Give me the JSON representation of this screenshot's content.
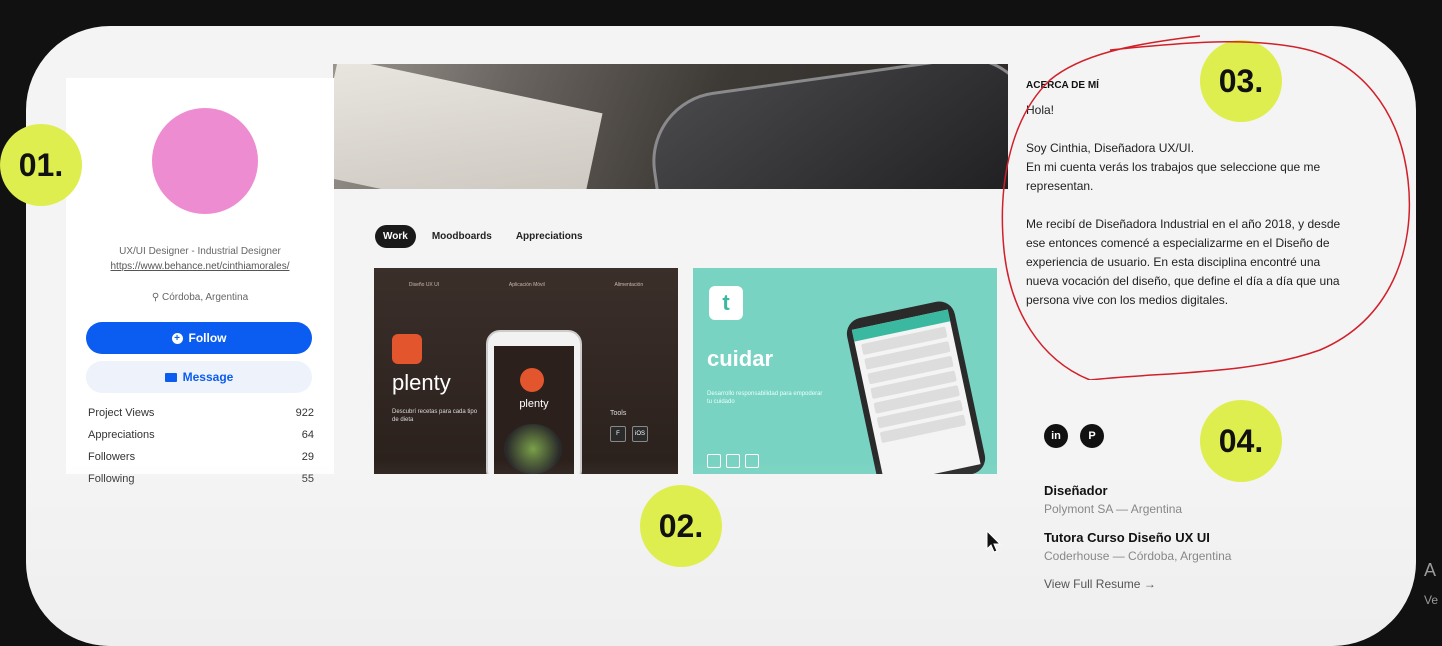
{
  "profile": {
    "role": "UX/UI Designer - Industrial Designer",
    "url": "https://www.behance.net/cinthiamorales/",
    "location": "Córdoba, Argentina",
    "follow_label": "Follow",
    "message_label": "Message",
    "stats": [
      {
        "label": "Project Views",
        "value": "922"
      },
      {
        "label": "Appreciations",
        "value": "64"
      },
      {
        "label": "Followers",
        "value": "29"
      },
      {
        "label": "Following",
        "value": "55"
      }
    ]
  },
  "tabs": [
    "Work",
    "Moodboards",
    "Appreciations"
  ],
  "projects": {
    "plenty": {
      "name": "plenty",
      "desc": "Descubrí recetas para cada tipo de dieta",
      "tools": "Tools",
      "top": [
        "Diseño UX UI",
        "Aplicación Móvil",
        "Alimentación"
      ],
      "tool_icons": [
        "F",
        "iOS"
      ]
    },
    "cuidar": {
      "name": "cuidar",
      "logo": "t",
      "desc": "Desarrollo responsabilidad para empoderar tu cuidado"
    }
  },
  "about": {
    "title": "ACERCA DE MÍ",
    "hello": "Hola!",
    "p1": "Soy Cinthia, Diseñadora UX/UI.",
    "p2": "En mi cuenta verás los trabajos que seleccione que me representan.",
    "p3": "Me recibí de Diseñadora Industrial en el año 2018, y desde ese entonces comencé a especializarme en el Diseño de experiencia de usuario. En esta disciplina encontré una nueva vocación del diseño, que define el día a día que una persona vive con los medios digitales."
  },
  "social": [
    "in",
    "P"
  ],
  "jobs": [
    {
      "title": "Diseñador",
      "sub": "Polymont SA — Argentina"
    },
    {
      "title": "Tutora Curso Diseño UX UI",
      "sub": "Coderhouse — Córdoba, Argentina"
    }
  ],
  "resume_label": "View Full Resume →",
  "badges": [
    "01.",
    "02.",
    "03.",
    "04."
  ],
  "watermark": "A",
  "watermark_sub": "Ve",
  "colors": {
    "accent": "#0b5cf0",
    "badge": "#dfee4f",
    "avatar": "#ee8cd2",
    "annotation": "#d1202a"
  }
}
